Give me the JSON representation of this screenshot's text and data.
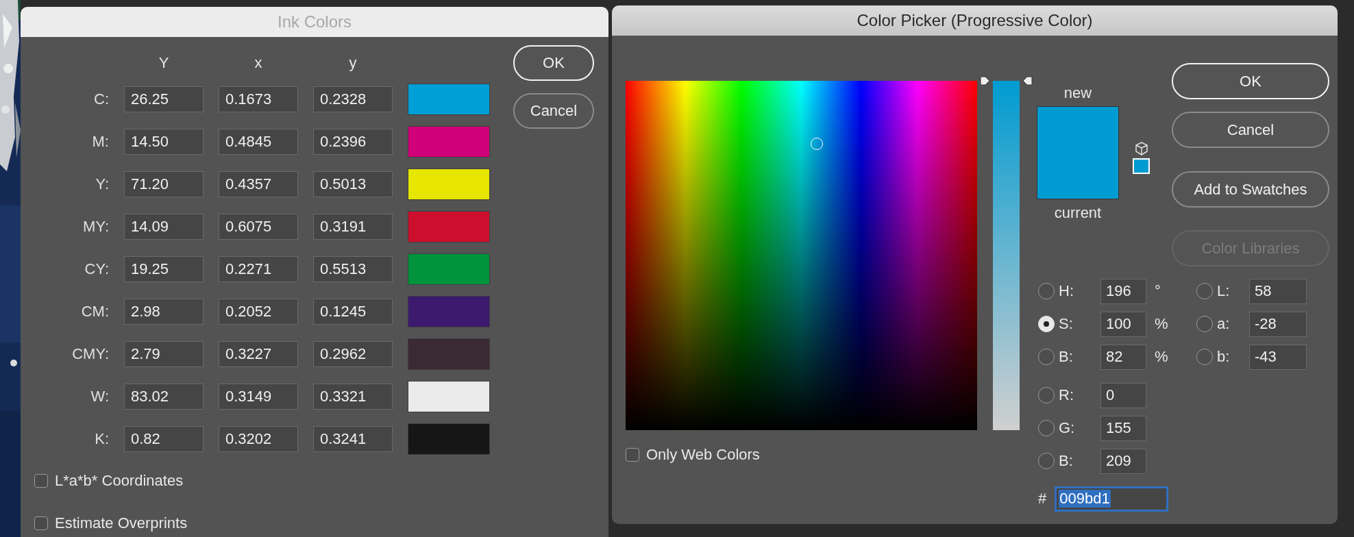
{
  "ink_colors": {
    "title": "Ink Colors",
    "active": false,
    "columns": [
      "Y",
      "x",
      "y"
    ],
    "inks": [
      {
        "label": "C:",
        "values": [
          "26.25",
          "0.1673",
          "0.2328"
        ],
        "color": "#009fd6"
      },
      {
        "label": "M:",
        "values": [
          "14.50",
          "0.4845",
          "0.2396"
        ],
        "color": "#d1007a"
      },
      {
        "label": "Y:",
        "values": [
          "71.20",
          "0.4357",
          "0.5013"
        ],
        "color": "#e6e600"
      },
      {
        "label": "MY:",
        "values": [
          "14.09",
          "0.6075",
          "0.3191"
        ],
        "color": "#cc0f2c"
      },
      {
        "label": "CY:",
        "values": [
          "19.25",
          "0.2271",
          "0.5513"
        ],
        "color": "#00943c"
      },
      {
        "label": "CM:",
        "values": [
          "2.98",
          "0.2052",
          "0.1245"
        ],
        "color": "#3d1a6e"
      },
      {
        "label": "CMY:",
        "values": [
          "2.79",
          "0.3227",
          "0.2962"
        ],
        "color": "#3a2a33"
      },
      {
        "label": "W:",
        "values": [
          "83.02",
          "0.3149",
          "0.3321"
        ],
        "color": "#ebebeb"
      },
      {
        "label": "K:",
        "values": [
          "0.82",
          "0.3202",
          "0.3241"
        ],
        "color": "#161616"
      }
    ],
    "checkboxes": [
      {
        "label": "L*a*b* Coordinates",
        "checked": false
      },
      {
        "label": "Estimate Overprints",
        "checked": false
      }
    ],
    "buttons": [
      {
        "label": "OK",
        "default": true
      },
      {
        "label": "Cancel",
        "default": false
      }
    ]
  },
  "color_picker": {
    "title": "Color Picker (Progressive Color)",
    "active": true,
    "saturation_slider": {
      "level": 1
    },
    "preview": {
      "new_label": "new",
      "current_label": "current",
      "color": "#009bd1"
    },
    "only_web_colors": {
      "label": "Only Web Colors",
      "checked": false
    },
    "buttons": [
      {
        "label": "OK",
        "default": true,
        "disabled": false
      },
      {
        "label": "Cancel",
        "default": false,
        "disabled": false
      },
      {
        "label": "Add to Swatches",
        "default": false,
        "disabled": false
      },
      {
        "label": "Color Libraries",
        "default": false,
        "disabled": true
      }
    ],
    "hsb": [
      {
        "label": "H:",
        "value": "196",
        "unit": "°",
        "selected": false
      },
      {
        "label": "S:",
        "value": "100",
        "unit": "%",
        "selected": true
      },
      {
        "label": "B:",
        "value": "82",
        "unit": "%",
        "selected": false
      }
    ],
    "lab": [
      {
        "label": "L:",
        "value": "58",
        "selected": false
      },
      {
        "label": "a:",
        "value": "-28",
        "selected": false
      },
      {
        "label": "b:",
        "value": "-43",
        "selected": false
      }
    ],
    "rgb": [
      {
        "label": "R:",
        "value": "0",
        "selected": false
      },
      {
        "label": "G:",
        "value": "155",
        "selected": false
      },
      {
        "label": "B:",
        "value": "209",
        "selected": false
      }
    ],
    "hex": {
      "label": "#",
      "value": "009bd1",
      "highlighted": true
    }
  }
}
